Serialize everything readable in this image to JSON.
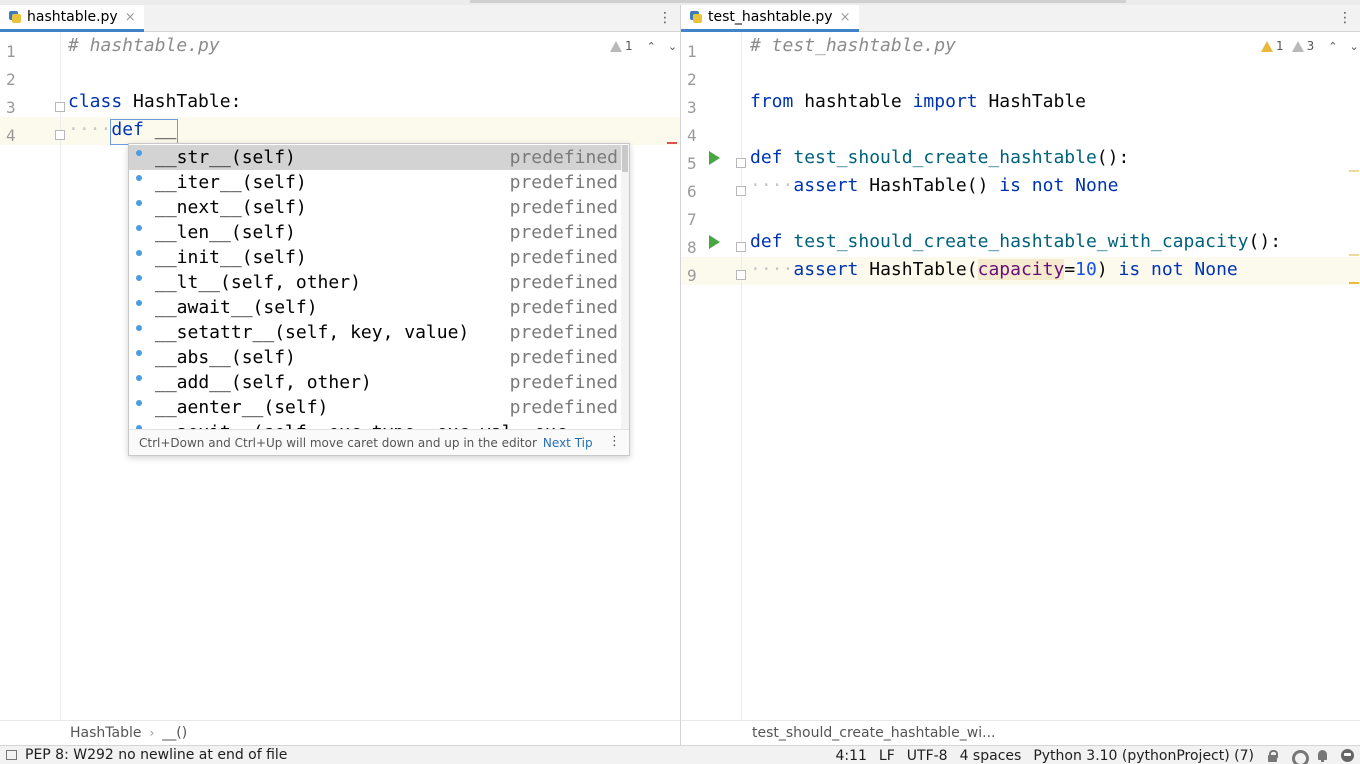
{
  "left_editor": {
    "tab": {
      "label": "hashtable.py",
      "close_glyph": "×"
    },
    "menu_glyph": "⋮",
    "inspection": {
      "warnings": "1",
      "prev_glyph": "⌃",
      "next_glyph": "⌄"
    },
    "lines": [
      {
        "no": "1",
        "comment": "# hashtable.py"
      },
      {
        "no": "2"
      },
      {
        "no": "3",
        "kw": "class",
        "name": "HashTable:"
      },
      {
        "no": "4",
        "indent": "····",
        "kw": "def",
        "typed": "__"
      }
    ],
    "breadcrumb": [
      "HashTable",
      "__()"
    ],
    "breadcrumb_sep": "›"
  },
  "completion": {
    "items": [
      {
        "name": "__str__(self)",
        "type": "predefined"
      },
      {
        "name": "__iter__(self)",
        "type": "predefined"
      },
      {
        "name": "__next__(self)",
        "type": "predefined"
      },
      {
        "name": "__len__(self)",
        "type": "predefined"
      },
      {
        "name": "__init__(self)",
        "type": "predefined"
      },
      {
        "name": "__lt__(self, other)",
        "type": "predefined"
      },
      {
        "name": "__await__(self)",
        "type": "predefined"
      },
      {
        "name": "__setattr__(self, key, value)",
        "type": "predefined"
      },
      {
        "name": "__abs__(self)",
        "type": "predefined"
      },
      {
        "name": "__add__(self, other)",
        "type": "predefined"
      },
      {
        "name": "__aenter__(self)",
        "type": "predefined"
      },
      {
        "name": "__aexit__(self, exc_type, exc_val, exc",
        "type": ""
      }
    ],
    "tip": "Ctrl+Down and Ctrl+Up will move caret down and up in the editor",
    "tip_link": "Next Tip",
    "tip_menu_glyph": "⋮"
  },
  "right_editor": {
    "tab": {
      "label": "test_hashtable.py",
      "close_glyph": "×"
    },
    "menu_glyph": "⋮",
    "inspection": {
      "warnings": "1",
      "weak_warnings": "3",
      "prev_glyph": "⌃",
      "next_glyph": "⌄"
    },
    "lines": [
      {
        "no": "1",
        "comment": "# test_hashtable.py"
      },
      {
        "no": "2"
      },
      {
        "no": "3",
        "kw1": "from",
        "mod": "hashtable",
        "kw2": "import",
        "name": "HashTable"
      },
      {
        "no": "4"
      },
      {
        "no": "5",
        "kw": "def",
        "fn": "test_should_create_hashtable",
        "rest": "():"
      },
      {
        "no": "6",
        "indent": "····",
        "kw": "assert",
        "body": "HashTable()",
        "kw2": "is not",
        "const": "None"
      },
      {
        "no": "7"
      },
      {
        "no": "8",
        "kw": "def",
        "fn": "test_should_create_hashtable_with_capacity",
        "rest": "():"
      },
      {
        "no": "9",
        "indent": "····",
        "kw": "assert",
        "body": "HashTable(",
        "param": "capacity",
        "eq": "=",
        "num": "10",
        "close": ")",
        "kw2": "is not",
        "const": "None"
      }
    ],
    "breadcrumb": "test_should_create_hashtable_wi..."
  },
  "status_bar": {
    "message": "PEP 8: W292 no newline at end of file",
    "position": "4:11",
    "line_sep": "LF",
    "encoding": "UTF-8",
    "indent": "4 spaces",
    "interpreter": "Python 3.10 (pythonProject) (7)"
  },
  "colors": {
    "keyword": "#0033b3",
    "function": "#00627a",
    "comment": "#8c8c8c",
    "number": "#1750eb",
    "param": "#660e7a",
    "tab_underline": "#4083c9",
    "run_icon": "#4aa543",
    "warning": "#e9b83c"
  }
}
